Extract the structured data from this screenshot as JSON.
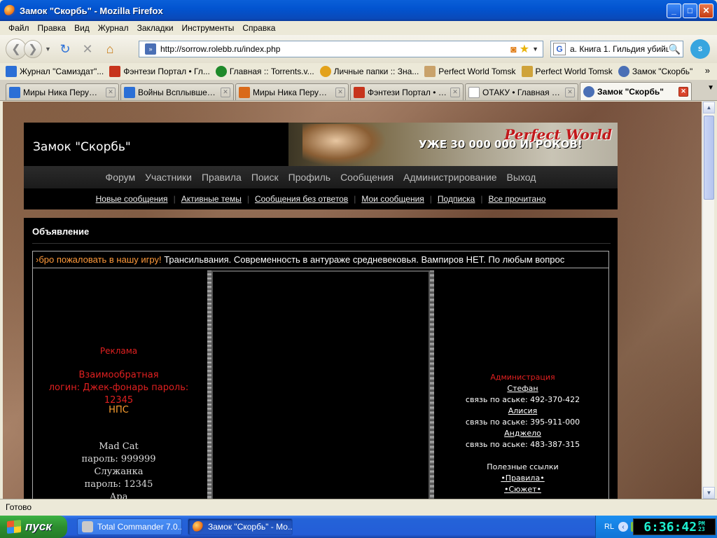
{
  "window": {
    "title": "Замок \"Скорбь\" - Mozilla Firefox"
  },
  "menu": [
    "Файл",
    "Правка",
    "Вид",
    "Журнал",
    "Закладки",
    "Инструменты",
    "Справка"
  ],
  "nav": {
    "url": "http://sorrow.rolebb.ru/index.php",
    "search_value": "а. Книга 1. Гильдия убийц"
  },
  "bookmarks": [
    {
      "label": "Журнал \"Самиздат\"...",
      "color": "#2b6fd6"
    },
    {
      "label": "Фэнтези Портал • Гл...",
      "color": "#c7341c"
    },
    {
      "label": "Главная :: Torrents.v...",
      "color": "#1f8a2a"
    },
    {
      "label": "Личные папки :: Зна...",
      "color": "#e3a21a"
    },
    {
      "label": "Perfect World Tomsk",
      "color": "#c9a26a"
    },
    {
      "label": "Perfect World Tomsk",
      "color": "#cfa33a"
    },
    {
      "label": "Замок \"Скорбь\"",
      "color": "#4a6fb5"
    }
  ],
  "tabs": [
    {
      "label": "Миры Ника Перумов...",
      "color": "#2b6fd6",
      "active": false
    },
    {
      "label": "Войны Всплывшего ...",
      "color": "#2b6fd6",
      "active": false
    },
    {
      "label": "Миры Ника Перумов...",
      "color": "#d96a1a",
      "active": false
    },
    {
      "label": "Фэнтези Портал • П...",
      "color": "#c7341c",
      "active": false
    },
    {
      "label": "ОТАКУ • Главная ст...",
      "color": "#bbbbbb",
      "active": false
    },
    {
      "label": "Замок \"Скорбь\"",
      "color": "#4a6fb5",
      "active": true
    }
  ],
  "forum": {
    "title": "Замок \"Скорбь\"",
    "banner_text": "УЖЕ 30 000 000 ИГРОКОВ!",
    "banner_logo": "Perfect World",
    "main_nav": [
      "Форум",
      "Участники",
      "Правила",
      "Поиск",
      "Профиль",
      "Сообщения",
      "Администрирование",
      "Выход"
    ],
    "sub_nav": [
      "Новые сообщения",
      "Активные темы",
      "Сообщения без ответов",
      "Мои сообщения",
      "Подписка",
      "Все прочитано"
    ]
  },
  "announcement": {
    "heading": "Объявление",
    "marquee_highlight": "›бро пожаловать в нашу игру!",
    "marquee_text": " Трансильвания. Современность в антураже средневековья. Вампиров НЕТ. По любым вопрос",
    "left": {
      "ads_title": "Реклама",
      "mutual_title": "Взаимообратная",
      "mutual_login": "логин: Джек-фонарь пароль: 12345",
      "nps_title": "НПС",
      "char1_name": "Mad Cat",
      "char1_pass": "пароль: 999999",
      "char2_name": "Служанка",
      "char2_pass": "пароль: 12345",
      "char3_name": "Ара"
    },
    "right": {
      "admin_title": "Администрация",
      "admins": [
        {
          "name": "Стефан",
          "contact": "связь по аське: 492-370-422"
        },
        {
          "name": "Алисия",
          "contact": "связь по аське: 395-911-000"
        },
        {
          "name": "Анджело",
          "contact": "связь по аське: 483-387-315"
        }
      ],
      "links_title": "Полезные ссылки",
      "links": [
        "•Правила•",
        "•Сюжет•"
      ]
    }
  },
  "status": "Готово",
  "taskbar": {
    "start_label": "пуск",
    "tasks": [
      {
        "label": "Total Commander 7.0...",
        "active": false
      },
      {
        "label": "Замок \"Скорбь\" - Мо...",
        "active": true
      }
    ],
    "lang": "RL",
    "clock": "6:36:42",
    "ampm": "PM",
    "seconds_small": "23"
  }
}
